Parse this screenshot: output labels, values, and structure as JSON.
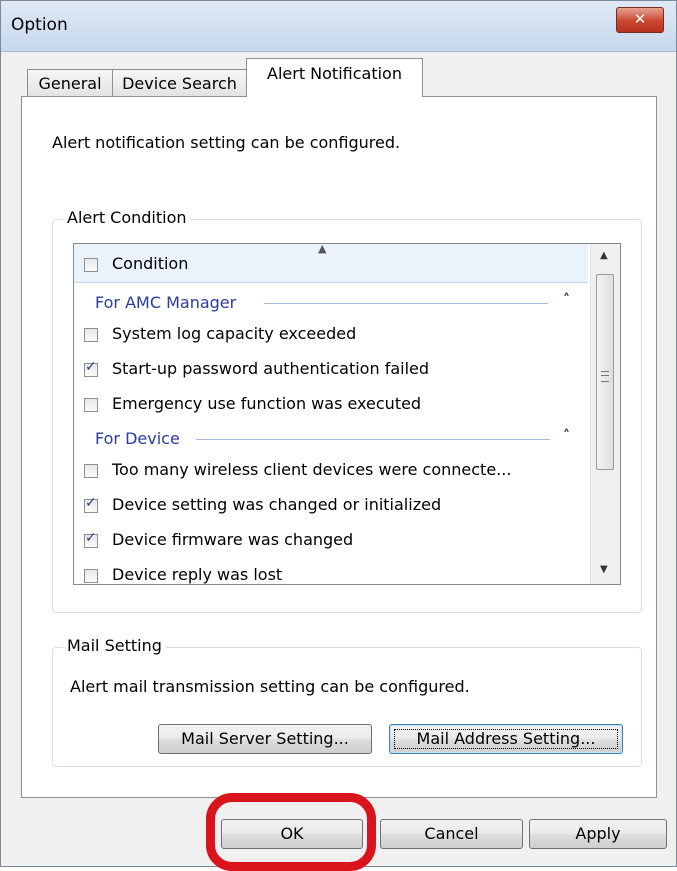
{
  "window": {
    "title": "Option",
    "close_icon": "close-icon"
  },
  "tabs": [
    {
      "label": "General",
      "active": false
    },
    {
      "label": "Device Search",
      "active": false
    },
    {
      "label": "Alert Notification",
      "active": true
    }
  ],
  "alert_tab": {
    "intro": "Alert notification setting can be configured.",
    "alert_condition": {
      "legend": "Alert Condition",
      "header": {
        "label": "Condition",
        "checked": false
      },
      "groups": [
        {
          "label": "For AMC Manager",
          "items": [
            {
              "label": "System log capacity exceeded",
              "checked": false
            },
            {
              "label": "Start-up password authentication failed",
              "checked": true
            },
            {
              "label": "Emergency use function was executed",
              "checked": false
            }
          ]
        },
        {
          "label": "For Device",
          "items": [
            {
              "label": "Too many wireless client devices were connecte...",
              "checked": false
            },
            {
              "label": "Device setting was changed or initialized",
              "checked": true
            },
            {
              "label": "Device firmware was changed",
              "checked": true
            },
            {
              "label": "Device reply was lost",
              "checked": false
            }
          ]
        }
      ]
    },
    "mail_setting": {
      "legend": "Mail Setting",
      "description": "Alert mail transmission setting can be configured.",
      "mail_server_button": "Mail Server Setting...",
      "mail_address_button": "Mail Address Setting..."
    }
  },
  "footer": {
    "ok": "OK",
    "cancel": "Cancel",
    "apply": "Apply"
  },
  "colors": {
    "group_label": "#2b3b9e",
    "highlight": "#d9141d",
    "title_bar": "#c7d8ee"
  }
}
